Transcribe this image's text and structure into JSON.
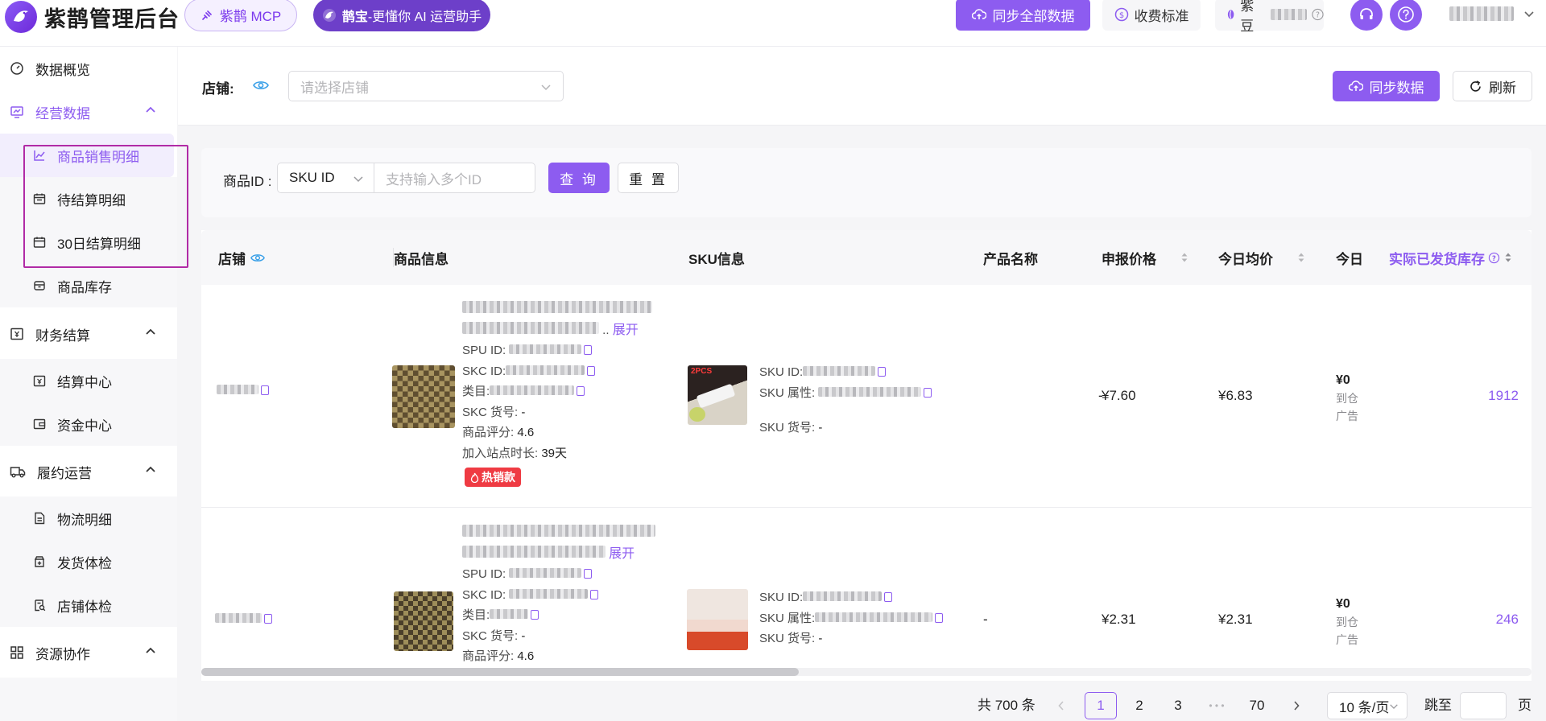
{
  "app": {
    "title": "紫鹊管理后台"
  },
  "topbar": {
    "mcp_label": "紫鹊 MCP",
    "ai_name": "鹊宝",
    "ai_tagline": "-更懂你 AI 运营助手",
    "sync_all_label": "同步全部数据",
    "fee_label": "收费标准",
    "beans_label": "紫豆"
  },
  "sidebar": {
    "items": [
      {
        "label": "数据概览",
        "icon": "dashboard-icon"
      },
      {
        "label": "经营数据",
        "icon": "monitor-chart-icon"
      },
      {
        "label": "商品销售明细",
        "icon": "line-chart-icon"
      },
      {
        "label": "待结算明细",
        "icon": "calendar-icon"
      },
      {
        "label": "30日结算明细",
        "icon": "calendar-icon"
      },
      {
        "label": "商品库存",
        "icon": "box-icon"
      },
      {
        "label": "财务结算",
        "icon": "yuan-receipt-icon"
      },
      {
        "label": "结算中心",
        "icon": "yuan-calendar-icon"
      },
      {
        "label": "资金中心",
        "icon": "wallet-icon"
      },
      {
        "label": "履约运营",
        "icon": "truck-icon"
      },
      {
        "label": "物流明细",
        "icon": "document-icon"
      },
      {
        "label": "发货体检",
        "icon": "package-plus-icon"
      },
      {
        "label": "店铺体检",
        "icon": "clipboard-search-icon"
      },
      {
        "label": "资源协作",
        "icon": "grid-icon"
      }
    ]
  },
  "filter": {
    "store_label": "店铺:",
    "store_placeholder": "请选择店铺",
    "sync_label": "同步数据",
    "refresh_label": "刷新"
  },
  "search": {
    "id_label": "商品ID :",
    "id_type": "SKU ID",
    "id_placeholder": "支持输入多个ID",
    "query_label": "查 询",
    "reset_label": "重 置"
  },
  "table": {
    "columns": [
      "店铺",
      "商品信息",
      "SKU信息",
      "产品名称",
      "申报价格",
      "今日均价",
      "今日",
      "实际已发货库存"
    ],
    "labels": {
      "spu": "SPU ID:",
      "skc": "SKC ID:",
      "category": "类目:",
      "skc_no": "SKC 货号:",
      "rating": "商品评分:",
      "days": "加入站点时长:",
      "sku_id": "SKU ID:",
      "sku_attr": "SKU 属性:",
      "sku_no": "SKU 货号:",
      "expand": "展开",
      "ellipsis": ".."
    },
    "rows": [
      {
        "skc_no_value": "-",
        "rating_value": "4.6",
        "days_value": "39天",
        "badge": "热销款",
        "sku_no_value": "-",
        "thumb_text": "2PCS",
        "product_name": "-",
        "declared_price": "¥7.60",
        "avg_price": "¥6.83",
        "today_value": "¥0",
        "today_line1": "到仓",
        "today_line2": "广告",
        "stock": "1912"
      },
      {
        "skc_no_value": "-",
        "rating_value": "4.6",
        "days_value": "",
        "badge": "",
        "sku_no_value": "-",
        "thumb_text": "",
        "product_name": "-",
        "declared_price": "¥2.31",
        "avg_price": "¥2.31",
        "today_value": "¥0",
        "today_line1": "到仓",
        "today_line2": "广告",
        "stock": "246"
      }
    ]
  },
  "pagination": {
    "total": "共 700 条",
    "pages": [
      "1",
      "2",
      "3",
      "70"
    ],
    "ellipsis": "• • •",
    "current": "1",
    "page_size": "10 条/页",
    "jump_label": "跳至",
    "page_suffix": "页"
  },
  "colors": {
    "accent": "#8d5cf0",
    "accent_dark": "#6d3fc9",
    "hot": "#ef3b43",
    "highlight_box": "#b12ba6"
  }
}
